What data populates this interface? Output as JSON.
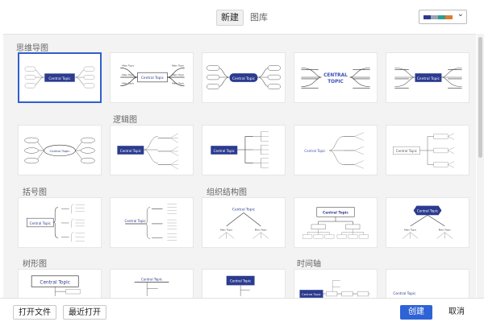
{
  "tabs": [
    {
      "label": "新建"
    },
    {
      "label": "图库"
    }
  ],
  "theme_colors": [
    "#2b3b8f",
    "#9aa3b5",
    "#2e9c8f",
    "#e07a2f"
  ],
  "sections": {
    "mindmap": "思维导图",
    "logic": "逻辑图",
    "brace": "括号图",
    "org": "组织结构图",
    "tree": "树形图",
    "timeline": "时间轴"
  },
  "card_texts": {
    "central_topic": "Central Topic",
    "central_topic_split": [
      "CENTRAL",
      "TOPIC"
    ],
    "main_topic": "Main Topic",
    "subtopic": "Subtopic"
  },
  "buttons": {
    "open_file": "打开文件",
    "recent_open": "最近打开",
    "create": "创建",
    "cancel": "取消"
  },
  "colors": {
    "accent": "#2e63d6",
    "topic_blue": "#2b3b8f",
    "topic_text": "#3d50b8"
  }
}
